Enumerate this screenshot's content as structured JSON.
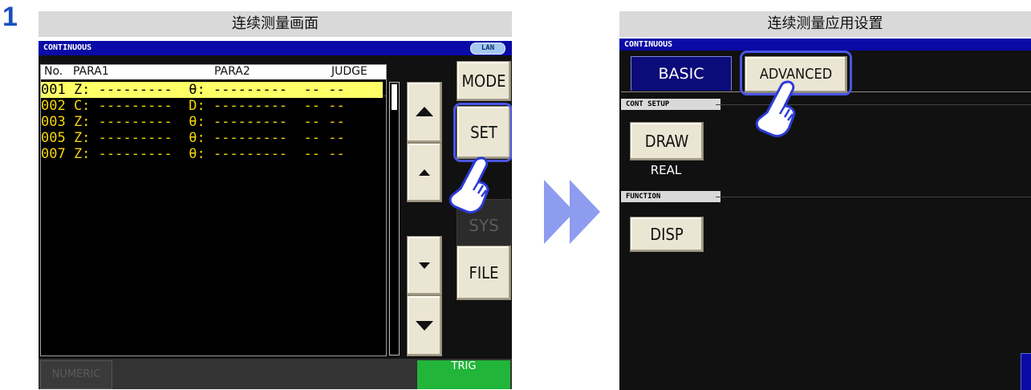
{
  "step": "1",
  "left": {
    "caption": "连续测量画面",
    "bar_title": "CONTINUOUS",
    "lan": "LAN",
    "columns": [
      "No.",
      "PARA1",
      "PARA2",
      "JUDGE"
    ],
    "rows": [
      {
        "text": "001 Z: ---------  θ: ---------  -- --",
        "selected": true
      },
      {
        "text": "002 C: ---------  D: ---------  -- --",
        "selected": false
      },
      {
        "text": "003 Z: ---------  θ: ---------  -- --",
        "selected": false
      },
      {
        "text": "005 Z: ---------  θ: ---------  -- --",
        "selected": false
      },
      {
        "text": "007 Z: ---------  θ: ---------  -- --",
        "selected": false
      }
    ],
    "buttons": {
      "mode": "MODE",
      "set": "SET",
      "sys": "SYS",
      "file": "FILE",
      "numeric": "NUMERIC",
      "trig": "TRIG"
    }
  },
  "right": {
    "caption": "连续测量应用设置",
    "bar_title": "CONTINUOUS",
    "tabs": {
      "basic": "BASIC",
      "advanced": "ADVANCED"
    },
    "sections": {
      "cont_setup": "CONT SETUP",
      "function": "FUNCTION"
    },
    "buttons": {
      "draw": "DRAW",
      "draw_value": "REAL",
      "disp": "DISP"
    }
  },
  "colors": {
    "title_bar": "#0a0aa6",
    "row_text": "#f5d60a",
    "selected_row": "#ffff66",
    "trig": "#21b53a",
    "highlight": "#4a55e6"
  }
}
